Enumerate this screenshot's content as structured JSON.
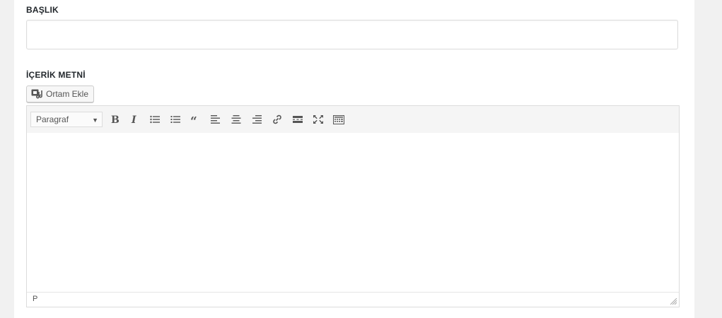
{
  "form": {
    "title_label": "BAŞLIK",
    "title_value": "",
    "content_label": "İÇERİK METNİ"
  },
  "media_button": {
    "label": "Ortam Ekle",
    "icon": "add-media-icon"
  },
  "editor": {
    "format_select": {
      "selected": "Paragraf"
    },
    "toolbar_icons": [
      "bold-icon",
      "italic-icon",
      "bulleted-list-icon",
      "numbered-list-icon",
      "blockquote-icon",
      "align-left-icon",
      "align-center-icon",
      "align-right-icon",
      "link-icon",
      "read-more-icon",
      "fullscreen-icon",
      "toolbar-toggle-icon"
    ],
    "content": "",
    "status_path": "P"
  },
  "colors": {
    "page_background": "#f1f1f1",
    "panel_background": "#ffffff",
    "icon_color": "#555555",
    "border": "#dddddd"
  }
}
